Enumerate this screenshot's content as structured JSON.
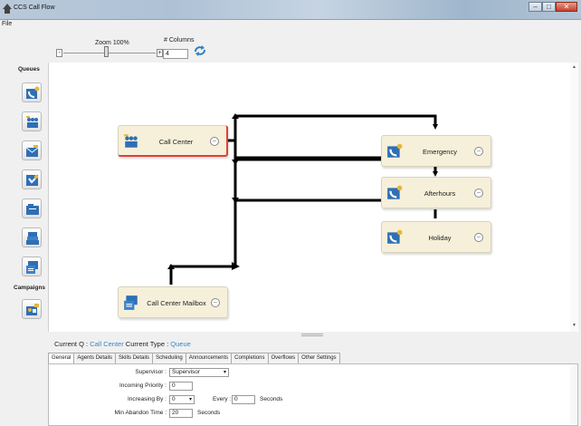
{
  "window": {
    "title": "CCS Call Flow"
  },
  "menu": {
    "file": "File"
  },
  "toolbar": {
    "zoom_label": "Zoom 100%",
    "columns_label": "# Columns",
    "columns_value": "4",
    "minus": "-",
    "plus": "+"
  },
  "sidebar": {
    "queues_header": "Queues",
    "campaigns_header": "Campaigns"
  },
  "nodes": {
    "call_center": "Call Center",
    "emergency": "Emergency",
    "afterhours": "Afterhours",
    "holiday": "Holiday",
    "mailbox": "Call Center Mailbox",
    "collapse_glyph": "–"
  },
  "current": {
    "q_label": "Current Q :",
    "q_value": "Call Center",
    "type_label": "Current Type :",
    "type_value": "Queue"
  },
  "tabs": [
    "General",
    "Agents Details",
    "Skills Details",
    "Scheduling",
    "Announcements",
    "Completions",
    "Overflows",
    "Other Settings"
  ],
  "form": {
    "supervisor_label": "Supervisor :",
    "supervisor_value": "Supervisor",
    "incoming_label": "Incoming Priority :",
    "incoming_value": "0",
    "increasing_label": "Increasing By :",
    "increasing_value": "0",
    "every_label": "Every :",
    "every_value": "0",
    "seconds_1": "Seconds",
    "min_abandon_label": "Min Abandon Time :",
    "min_abandon_value": "20",
    "seconds_2": "Seconds"
  },
  "colors": {
    "accent": "#3a86c8",
    "node_bg": "#f6f0da",
    "selected_border": "#e0403a"
  }
}
